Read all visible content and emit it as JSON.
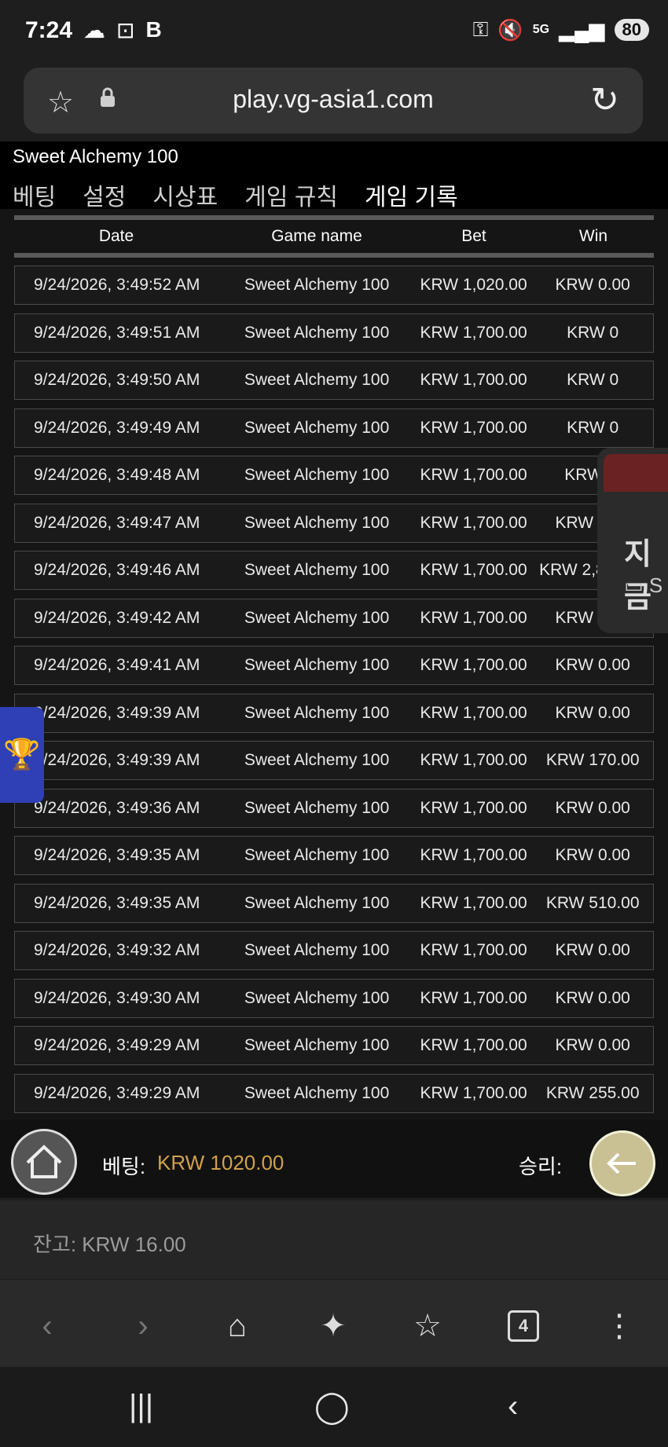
{
  "status_bar": {
    "time": "7:24",
    "left_icons": [
      "cloud-icon",
      "screenshot-icon",
      "b-app-icon"
    ],
    "right_icons": [
      "key-icon",
      "mute-icon",
      "5g-icon",
      "signal-icon"
    ],
    "network": "5G",
    "battery": "80"
  },
  "browser": {
    "url": "play.vg-asia1.com"
  },
  "game": {
    "title": "Sweet Alchemy 100",
    "tabs": [
      {
        "label": "베팅"
      },
      {
        "label": "설정"
      },
      {
        "label": "시상표"
      },
      {
        "label": "게임 규칙"
      },
      {
        "label": "게임 기록"
      }
    ],
    "active_tab": "게임 기록",
    "table": {
      "headers": {
        "date": "Date",
        "game": "Game name",
        "bet": "Bet",
        "win": "Win"
      },
      "rows": [
        {
          "date": "9/24/2026, 3:49:52 AM",
          "game": "Sweet Alchemy 100",
          "bet": "KRW 1,020.00",
          "win": "KRW 0.00"
        },
        {
          "date": "9/24/2026, 3:49:51 AM",
          "game": "Sweet Alchemy 100",
          "bet": "KRW 1,700.00",
          "win": "KRW 0"
        },
        {
          "date": "9/24/2026, 3:49:50 AM",
          "game": "Sweet Alchemy 100",
          "bet": "KRW 1,700.00",
          "win": "KRW 0"
        },
        {
          "date": "9/24/2026, 3:49:49 AM",
          "game": "Sweet Alchemy 100",
          "bet": "KRW 1,700.00",
          "win": "KRW 0"
        },
        {
          "date": "9/24/2026, 3:49:48 AM",
          "game": "Sweet Alchemy 100",
          "bet": "KRW 1,700.00",
          "win": "KRW 0."
        },
        {
          "date": "9/24/2026, 3:49:47 AM",
          "game": "Sweet Alchemy 100",
          "bet": "KRW 1,700.00",
          "win": "KRW 0.00"
        },
        {
          "date": "9/24/2026, 3:49:46 AM",
          "game": "Sweet Alchemy 100",
          "bet": "KRW 1,700.00",
          "win": "KRW 2,805.00"
        },
        {
          "date": "9/24/2026, 3:49:42 AM",
          "game": "Sweet Alchemy 100",
          "bet": "KRW 1,700.00",
          "win": "KRW 0.00"
        },
        {
          "date": "9/24/2026, 3:49:41 AM",
          "game": "Sweet Alchemy 100",
          "bet": "KRW 1,700.00",
          "win": "KRW 0.00"
        },
        {
          "date": "9/24/2026, 3:49:39 AM",
          "game": "Sweet Alchemy 100",
          "bet": "KRW 1,700.00",
          "win": "KRW 0.00"
        },
        {
          "date": "9/24/2026, 3:49:39 AM",
          "game": "Sweet Alchemy 100",
          "bet": "KRW 1,700.00",
          "win": "KRW 170.00"
        },
        {
          "date": "9/24/2026, 3:49:36 AM",
          "game": "Sweet Alchemy 100",
          "bet": "KRW 1,700.00",
          "win": "KRW 0.00"
        },
        {
          "date": "9/24/2026, 3:49:35 AM",
          "game": "Sweet Alchemy 100",
          "bet": "KRW 1,700.00",
          "win": "KRW 0.00"
        },
        {
          "date": "9/24/2026, 3:49:35 AM",
          "game": "Sweet Alchemy 100",
          "bet": "KRW 1,700.00",
          "win": "KRW 510.00"
        },
        {
          "date": "9/24/2026, 3:49:32 AM",
          "game": "Sweet Alchemy 100",
          "bet": "KRW 1,700.00",
          "win": "KRW 0.00"
        },
        {
          "date": "9/24/2026, 3:49:30 AM",
          "game": "Sweet Alchemy 100",
          "bet": "KRW 1,700.00",
          "win": "KRW 0.00"
        },
        {
          "date": "9/24/2026, 3:49:29 AM",
          "game": "Sweet Alchemy 100",
          "bet": "KRW 1,700.00",
          "win": "KRW 0.00"
        },
        {
          "date": "9/24/2026, 3:49:29 AM",
          "game": "Sweet Alchemy 100",
          "bet": "KRW 1,700.00",
          "win": "KRW 255.00"
        }
      ]
    },
    "popup": {
      "text": "지금",
      "sub": "S"
    },
    "bottom": {
      "bet_label": "베팅:",
      "bet_value": "KRW 1020.00",
      "win_label": "승리:"
    },
    "balance": "잔고: KRW 16.00"
  },
  "browser_nav": {
    "tab_count": "4"
  },
  "colors": {
    "background": "#151515",
    "accent_active_tab": "#b76b3b",
    "bet_value": "#d0a14a",
    "back_button": "#c9c094",
    "trophy_tab": "#2f3fb6"
  }
}
